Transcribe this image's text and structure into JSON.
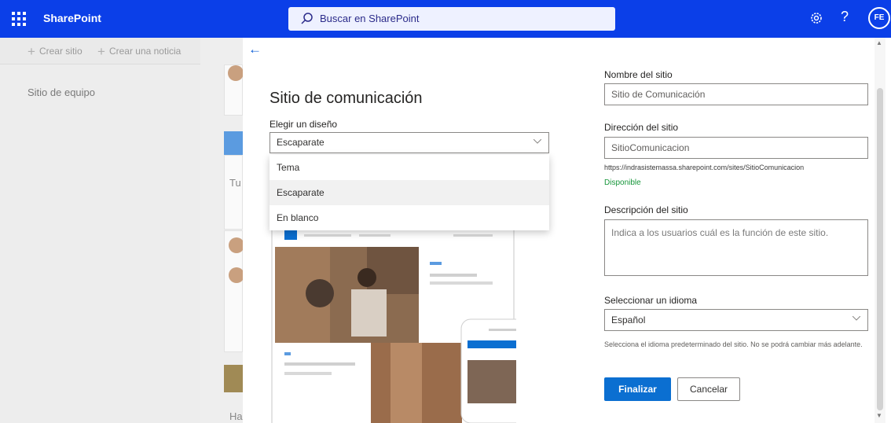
{
  "suite": {
    "app_name": "SharePoint",
    "search_placeholder": "Buscar en SharePoint",
    "avatar_initials": "FE",
    "help_glyph": "?"
  },
  "background": {
    "create_site": "Crear sitio",
    "create_news": "Crear una noticia",
    "left_link": "Sitio de equipo",
    "mid_text_1": "Tu",
    "mid_text_2": "Ha"
  },
  "panel": {
    "title": "Sitio de comunicación",
    "design_label": "Elegir un diseño",
    "design_selected": "Escaparate",
    "design_options": [
      "Tema",
      "Escaparate",
      "En blanco"
    ],
    "site_name_label": "Nombre del sitio",
    "site_name_value": "Sitio de Comunicación",
    "site_address_label": "Dirección del sitio",
    "site_address_value": "SitioComunicacion",
    "site_url": "https://indrasistemassa.sharepoint.com/sites/SitioComunicacion",
    "availability": "Disponible",
    "description_label": "Descripción del sitio",
    "description_placeholder": "Indica a los usuarios cuál es la función de este sitio.",
    "language_label": "Seleccionar un idioma",
    "language_value": "Español",
    "language_help": "Selecciona el idioma predeterminado del sitio. No se podrá cambiar más adelante.",
    "finish_button": "Finalizar",
    "cancel_button": "Cancelar"
  },
  "colors": {
    "suite_bar": "#0b3fe8",
    "primary": "#0b6fd1",
    "available": "#16963a"
  }
}
